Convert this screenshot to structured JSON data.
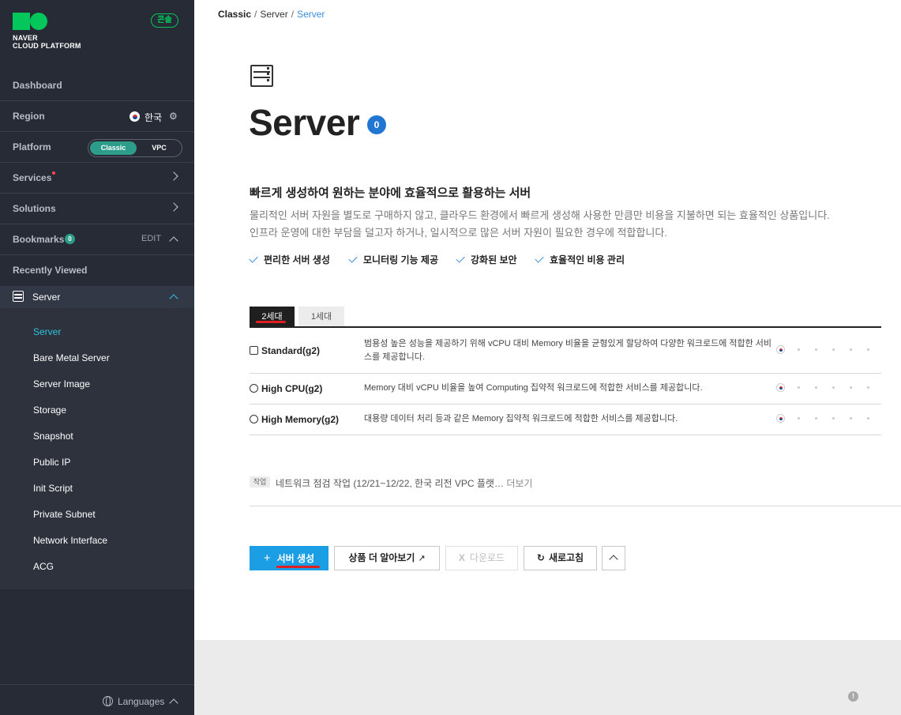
{
  "sidebar": {
    "logo": {
      "line1": "NAVER",
      "line2": "CLOUD PLATFORM"
    },
    "console_badge": "콘솔",
    "dashboard": "Dashboard",
    "region": {
      "label": "Region",
      "value": "한국"
    },
    "platform": {
      "label": "Platform",
      "options": [
        "Classic",
        "VPC"
      ],
      "selected": "Classic"
    },
    "services": "Services",
    "solutions": "Solutions",
    "bookmarks": {
      "label": "Bookmarks",
      "count": "0",
      "edit": "EDIT"
    },
    "recently_viewed": "Recently Viewed",
    "server_group": "Server",
    "items": [
      {
        "label": "Server",
        "active": true
      },
      {
        "label": "Bare Metal Server"
      },
      {
        "label": "Server Image"
      },
      {
        "label": "Storage"
      },
      {
        "label": "Snapshot"
      },
      {
        "label": "Public IP"
      },
      {
        "label": "Init Script"
      },
      {
        "label": "Private Subnet"
      },
      {
        "label": "Network Interface"
      },
      {
        "label": "ACG"
      }
    ],
    "languages": "Languages"
  },
  "breadcrumb": [
    "Classic",
    "Server",
    "Server"
  ],
  "page": {
    "title": "Server",
    "count": "0",
    "desc_title": "빠르게 생성하여 원하는 분야에 효율적으로 활용하는 서버",
    "desc_lines": [
      "물리적인 서버 자원을 별도로 구매하지 않고, 클라우드 환경에서 빠르게 생성해 사용한 만큼만 비용을 지불하면 되는 효율적인 상품입니다.",
      "인프라 운영에 대한 부담을 덜고자 하거나, 일시적으로 많은 서버 자원이 필요한 경우에 적합합니다."
    ],
    "features": [
      "편리한 서버 생성",
      "모니터링 기능 제공",
      "강화된 보안",
      "효율적인 비용 관리"
    ]
  },
  "generation_tabs": {
    "active": "2세대",
    "inactive": "1세대"
  },
  "specs": [
    {
      "name": "Standard(g2)",
      "desc": "범용성 높은 성능을 제공하기 위해 vCPU 대비 Memory 비율을 균형있게 할당하여 다양한 워크로드에 적합한 서비스를 제공합니다."
    },
    {
      "name": "High CPU(g2)",
      "desc": "Memory 대비 vCPU 비율을 높여 Computing 집약적 워크로드에 적합한 서비스를 제공합니다."
    },
    {
      "name": "High Memory(g2)",
      "desc": "대용량 데이터 처리 등과 같은 Memory 집약적 워크로드에 적합한 서비스를 제공합니다."
    }
  ],
  "notice": {
    "tag": "작업",
    "text": "네트워크 점검 작업 (12/21~12/22, 한국 리전 VPC 플랫…",
    "more": "더보기"
  },
  "actions": {
    "create": "서버 생성",
    "learn_more": "상품 더 알아보기",
    "download": "다운로드",
    "refresh": "새로고침"
  },
  "colors": {
    "sidebar_bg": "#262b35",
    "accent_green": "#03c75a",
    "primary_blue": "#1c9ee5",
    "active_teal": "#2fc4e0",
    "annotation_red": "#e02020"
  }
}
